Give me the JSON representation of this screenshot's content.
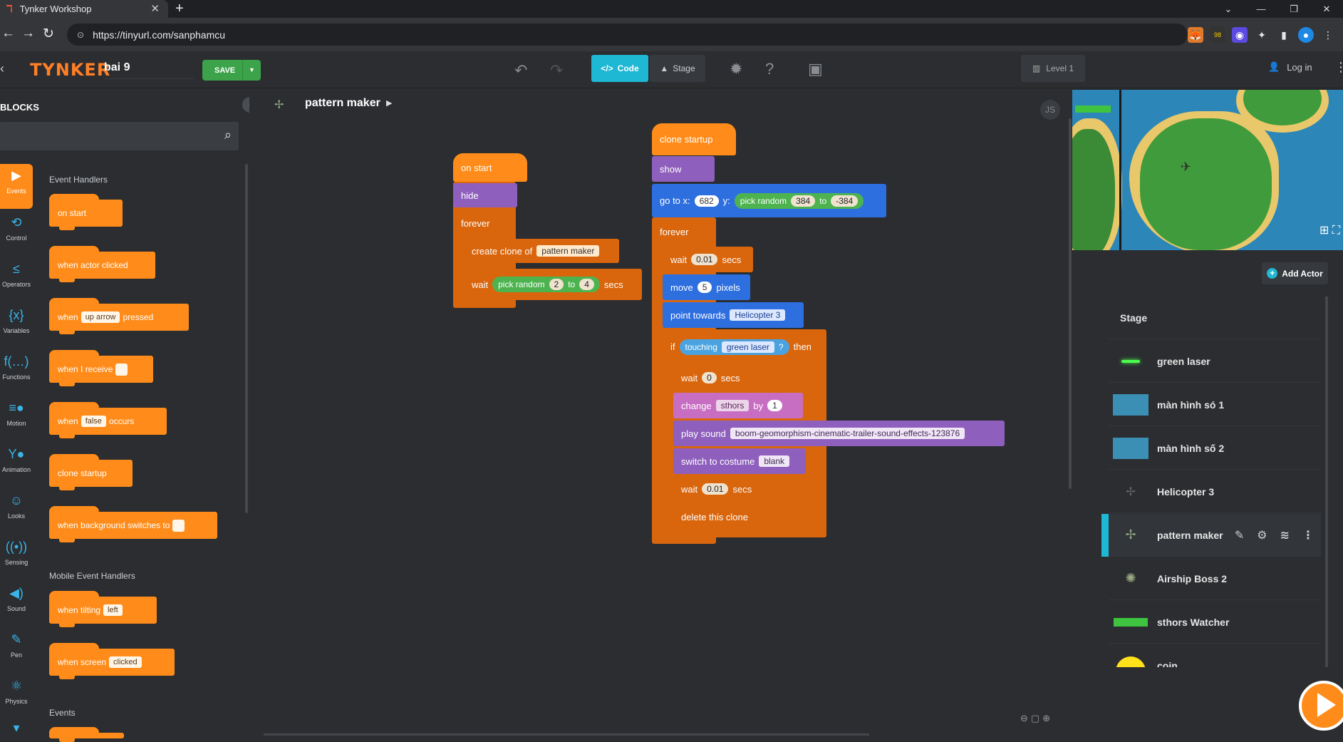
{
  "browser": {
    "tab_title": "Tynker Workshop",
    "url": "https://tinyurl.com/sanphamcu"
  },
  "header": {
    "brand": "TYNKER",
    "project_name": "bai 9",
    "save_label": "SAVE",
    "code_tab": "Code",
    "stage_tab": "Stage",
    "level_label": "Level 1",
    "login_label": "Log in"
  },
  "palette": {
    "title": "BLOCKS",
    "search_placeholder": "",
    "categories": [
      "Events",
      "Control",
      "Operators",
      "Variables",
      "Functions",
      "Motion",
      "Animation",
      "Looks",
      "Sensing",
      "Sound",
      "Pen",
      "Physics"
    ],
    "section1": "Event Handlers",
    "section2": "Mobile Event Handlers",
    "section3": "Events",
    "blocks": {
      "on_start": "on start",
      "when_actor_clicked": "when actor clicked",
      "when_key_1": "when",
      "when_key_val": "up arrow",
      "when_key_2": "pressed",
      "when_receive": "when I receive",
      "when_occurs_1": "when",
      "when_occurs_val": "false",
      "when_occurs_2": "occurs",
      "clone_startup": "clone startup",
      "when_bg": "when background switches to",
      "tilting_1": "when tilting",
      "tilting_val": "left",
      "screen_1": "when screen",
      "screen_val": "clicked"
    }
  },
  "canvas": {
    "actor_name": "pattern maker",
    "js_label": "JS",
    "script1": {
      "hat": "on start",
      "hide": "hide",
      "forever": "forever",
      "create_clone": "create clone of",
      "create_clone_val": "pattern maker",
      "wait": "wait",
      "pick_random": "pick random",
      "pick_a": "2",
      "pick_to": "to",
      "pick_b": "4",
      "secs": "secs"
    },
    "script2": {
      "hat": "clone startup",
      "show": "show",
      "goto": "go to x:",
      "goto_x": "682",
      "goto_y": "y:",
      "pick_random": "pick random",
      "pick_a": "384",
      "pick_to": "to",
      "pick_b": "-384",
      "forever": "forever",
      "wait1": "wait",
      "wait1_val": "0.01",
      "secs": "secs",
      "move": "move",
      "move_val": "5",
      "pixels": "pixels",
      "point": "point towards",
      "point_val": "Helicopter 3",
      "if": "if",
      "touching": "touching",
      "touching_val": "green laser",
      "q": "?",
      "then": "then",
      "wait2": "wait",
      "wait2_val": "0",
      "change": "change",
      "change_var": "sthors",
      "by": "by",
      "change_val": "1",
      "play_sound": "play sound",
      "sound_val": "boom-geomorphism-cinematic-trailer-sound-effects-123876",
      "switch_costume": "switch to costume",
      "costume_val": "blank",
      "wait3": "wait",
      "wait3_val": "0.01",
      "delete": "delete this clone"
    }
  },
  "actors": {
    "add_label": "Add Actor",
    "items": [
      {
        "name": "Stage"
      },
      {
        "name": "green laser"
      },
      {
        "name": "màn hình só 1"
      },
      {
        "name": "màn hình số 2"
      },
      {
        "name": "Helicopter 3"
      },
      {
        "name": "pattern maker"
      },
      {
        "name": "Airship Boss 2"
      },
      {
        "name": "sthors Watcher"
      },
      {
        "name": "coin"
      }
    ]
  },
  "colors": {
    "events": "#ff8c1a",
    "code_tab": "#1eb8d4",
    "save": "#3ca34a"
  }
}
